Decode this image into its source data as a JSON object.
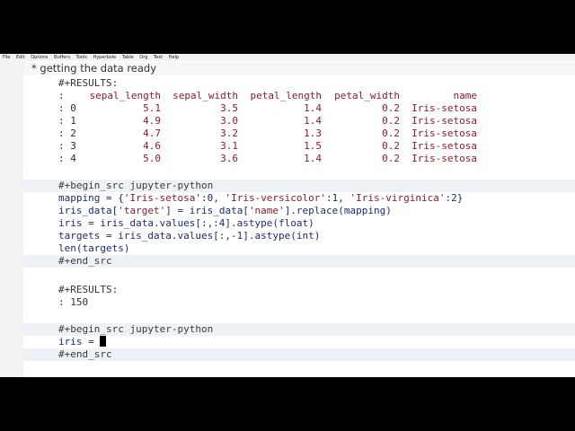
{
  "menu": [
    "File",
    "Edit",
    "Options",
    "Buffers",
    "Tools",
    "Hyperbole",
    "Table",
    "Org",
    "Text",
    "Help"
  ],
  "heading": "* getting the data ready",
  "results1": {
    "label": "#+RESULTS:",
    "header": {
      "prefix": ":",
      "cols": [
        "sepal_length",
        "sepal_width",
        "petal_length",
        "petal_width",
        "name"
      ]
    },
    "rows": [
      {
        "idx": ": 0",
        "vals": [
          "5.1",
          "3.5",
          "1.4",
          "0.2",
          "Iris-setosa"
        ]
      },
      {
        "idx": ": 1",
        "vals": [
          "4.9",
          "3.0",
          "1.4",
          "0.2",
          "Iris-setosa"
        ]
      },
      {
        "idx": ": 2",
        "vals": [
          "4.7",
          "3.2",
          "1.3",
          "0.2",
          "Iris-setosa"
        ]
      },
      {
        "idx": ": 3",
        "vals": [
          "4.6",
          "3.1",
          "1.5",
          "0.2",
          "Iris-setosa"
        ]
      },
      {
        "idx": ": 4",
        "vals": [
          "5.0",
          "3.6",
          "1.4",
          "0.2",
          "Iris-setosa"
        ]
      }
    ]
  },
  "src1": {
    "begin": "#+begin_src jupyter-python",
    "lines": [
      "mapping = {'Iris-setosa':0, 'Iris-versicolor':1, 'Iris-virginica':2}",
      "iris_data['target'] = iris_data['name'].replace(mapping)",
      "iris = iris_data.values[:,:4].astype(float)",
      "targets = iris_data.values[:,-1].astype(int)",
      "len(targets)"
    ],
    "end": "#+end_src"
  },
  "results2": {
    "label": "#+RESULTS:",
    "value": ": 150"
  },
  "src2": {
    "begin": "#+begin_src jupyter-python",
    "line": "iris = ",
    "end": "#+end_src"
  }
}
